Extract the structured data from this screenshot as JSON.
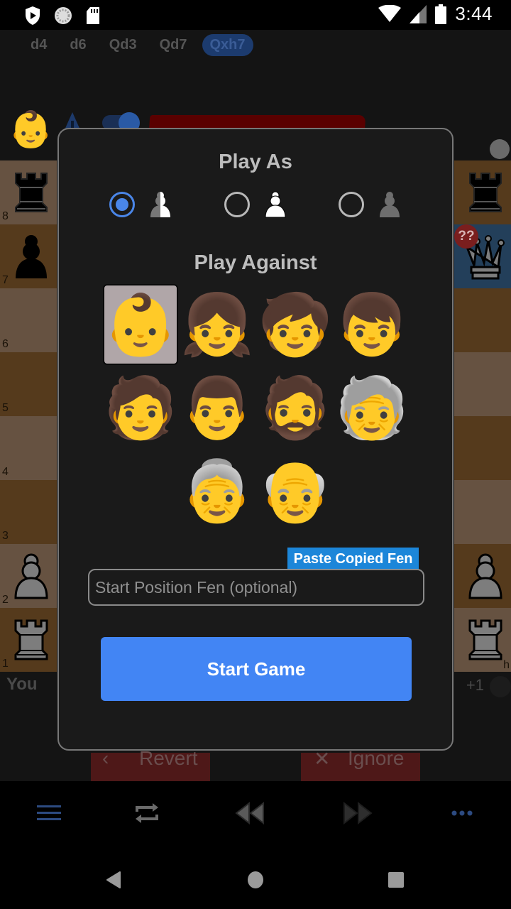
{
  "status_bar": {
    "time": "3:44",
    "icons": [
      "shield-play-icon",
      "sync-circle-icon",
      "sd-card-icon",
      "wifi-icon",
      "cell-signal-icon",
      "battery-icon"
    ]
  },
  "move_list": {
    "moves": [
      "d4",
      "d6",
      "Qd3",
      "Qd7",
      "Qxh7"
    ],
    "active_index": 4
  },
  "board": {
    "rank_labels": [
      "8",
      "7",
      "6",
      "5",
      "4",
      "3",
      "2",
      "1"
    ],
    "visible_file_label": "h",
    "annotation_badge": "??",
    "highlight_color": "#233f5a"
  },
  "players": {
    "opponent_avatar": "👶",
    "you_label": "You",
    "material_diff": "+1"
  },
  "background_actions": {
    "revert_label": "Revert",
    "ignore_label": "Ignore"
  },
  "dialog": {
    "play_as_title": "Play As",
    "play_as_options": [
      {
        "name": "random",
        "icon": "half-pawn-icon",
        "checked": true
      },
      {
        "name": "white",
        "icon": "white-pawn-icon",
        "checked": false
      },
      {
        "name": "black",
        "icon": "black-pawn-icon",
        "checked": false
      }
    ],
    "play_against_title": "Play Against",
    "opponents": [
      {
        "emoji": "👶",
        "name": "baby",
        "selected": true
      },
      {
        "emoji": "👧",
        "name": "girl",
        "selected": false
      },
      {
        "emoji": "🧒",
        "name": "child",
        "selected": false
      },
      {
        "emoji": "👦",
        "name": "boy",
        "selected": false
      },
      {
        "emoji": "🧑",
        "name": "person",
        "selected": false
      },
      {
        "emoji": "👨",
        "name": "man",
        "selected": false
      },
      {
        "emoji": "🧔",
        "name": "bearded-person",
        "selected": false
      },
      {
        "emoji": "🧓",
        "name": "older-person",
        "selected": false
      },
      {
        "emoji": "👵",
        "name": "old-woman",
        "selected": false
      },
      {
        "emoji": "👴",
        "name": "old-man",
        "selected": false
      }
    ],
    "paste_fen_label": "Paste Copied Fen",
    "fen_input": {
      "value": "",
      "placeholder": "Start Position Fen (optional)"
    },
    "start_label": "Start Game",
    "accent_color": "#4285f4"
  },
  "toolbar": {
    "buttons": [
      "menu-icon",
      "flip-board-icon",
      "rewind-icon",
      "fast-forward-icon",
      "more-icon"
    ]
  },
  "nav_bar": {
    "buttons": [
      "back-icon",
      "home-icon",
      "recents-icon"
    ]
  }
}
